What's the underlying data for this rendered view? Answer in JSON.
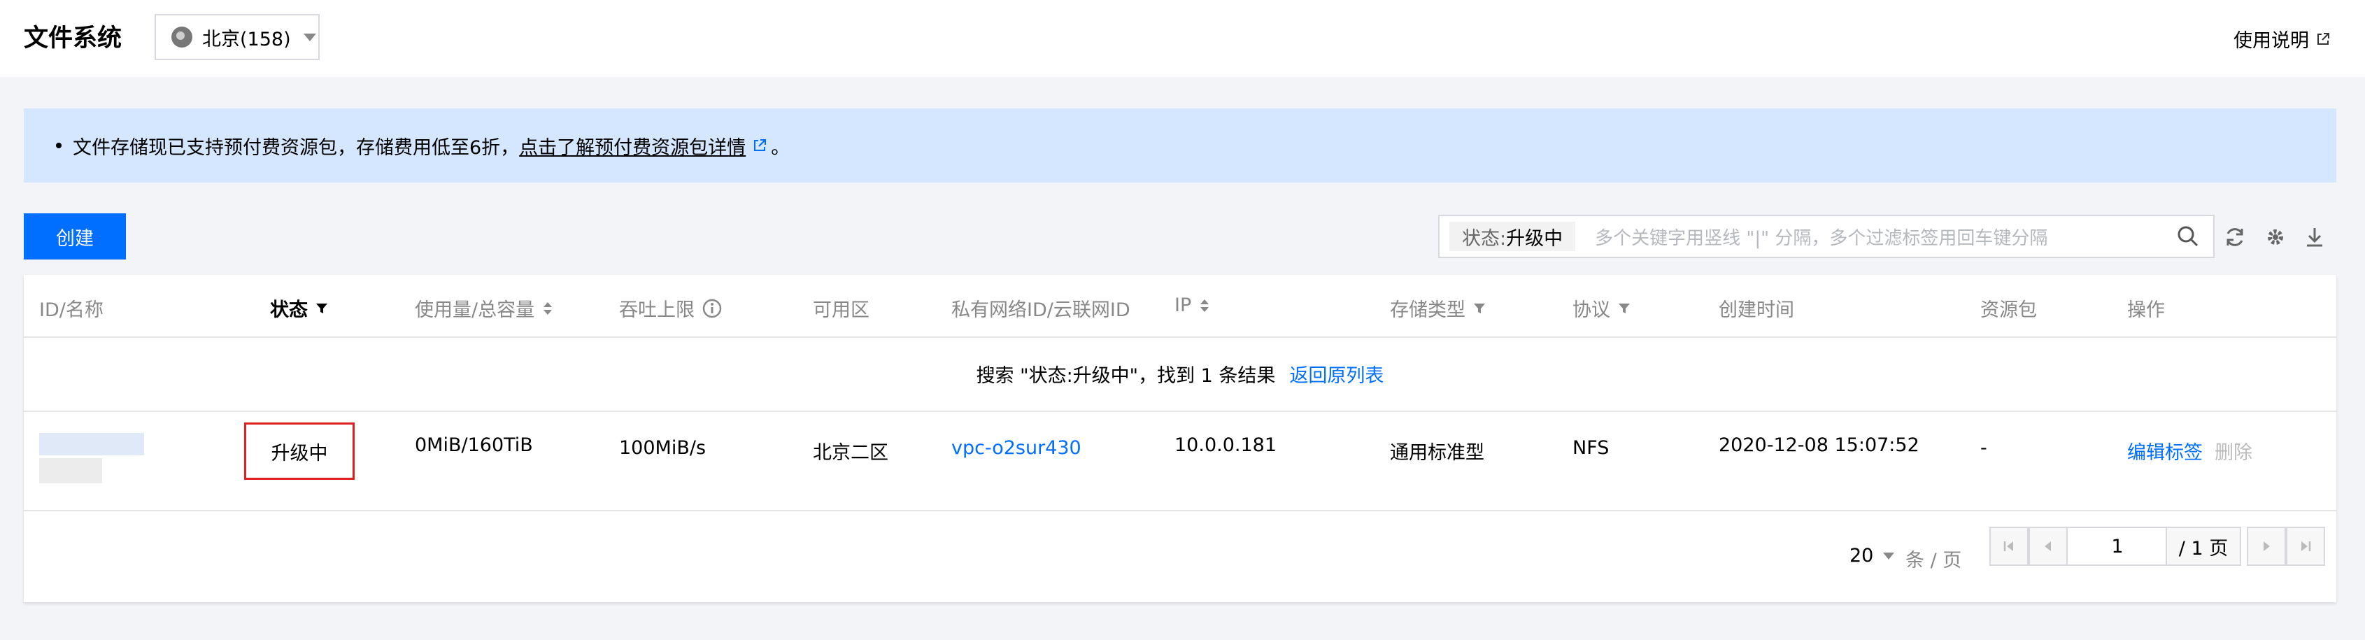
{
  "header": {
    "title": "文件系统",
    "region_label": "北京(158)",
    "help_label": "使用说明"
  },
  "notice": {
    "text": "文件存储现已支持预付费资源包，存储费用低至6折，",
    "link_text": "点击了解预付费资源包详情",
    "trail": "。"
  },
  "toolbar": {
    "create_label": "创建",
    "filter_key": "状态:",
    "filter_value": "升级中",
    "search_placeholder": "多个关键字用竖线 \"|\" 分隔，多个过滤标签用回车键分隔"
  },
  "table": {
    "columns": [
      "ID/名称",
      "状态",
      "使用量/总容量",
      "吞吐上限",
      "可用区",
      "私有网络ID/云联网ID",
      "IP",
      "存储类型",
      "协议",
      "创建时间",
      "资源包",
      "操作"
    ],
    "search_result_text": "搜索 \"状态:升级中\"，找到 1 条结果",
    "back_label": "返回原列表",
    "rows": [
      {
        "status": "升级中",
        "usage": "0MiB/160TiB",
        "throughput": "100MiB/s",
        "zone": "北京二区",
        "vpc": "vpc-o2sur430",
        "ip": "10.0.0.181",
        "storage_type": "通用标准型",
        "protocol": "NFS",
        "created": "2020-12-08 15:07:52",
        "package": "-",
        "edit_tag": "编辑标签",
        "delete": "删除"
      }
    ]
  },
  "pagination": {
    "page_size": "20",
    "page_size_unit": "条 / 页",
    "current_page": "1",
    "total_pages": "/ 1 页"
  },
  "colors": {
    "accent": "#006eff",
    "notice_bg": "#d5e7ff",
    "highlight_border": "#e02020"
  }
}
